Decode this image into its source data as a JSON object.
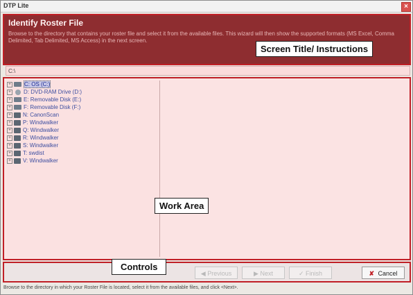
{
  "window": {
    "title": "DTP Lite",
    "close_label": "×"
  },
  "header": {
    "heading": "Identify Roster File",
    "instructions": "Browse to the directory that contains your roster file and select it from the available files. This wizard will then show the supported formats (MS Excel, Comma Delimited, Tab Delimited, MS Access) in the next screen."
  },
  "callouts": {
    "screen_title": "Screen Title/ Instructions",
    "work_area": "Work Area",
    "controls": "Controls"
  },
  "path": "C:\\",
  "tree": [
    {
      "expander": "+",
      "icon": "hard-drive-icon",
      "label": "C: OS (C:)",
      "selected": true
    },
    {
      "expander": "+",
      "icon": "cd-drive-icon",
      "label": "D: DVD-RAM Drive (D:)",
      "selected": false
    },
    {
      "expander": "+",
      "icon": "removable-disk-icon",
      "label": "E: Removable Disk (E:)",
      "selected": false
    },
    {
      "expander": "+",
      "icon": "removable-disk-icon",
      "label": "F: Removable Disk (F:)",
      "selected": false
    },
    {
      "expander": "+",
      "icon": "network-drive-icon",
      "label": "N: CanonScan",
      "selected": false
    },
    {
      "expander": "+",
      "icon": "network-drive-icon",
      "label": "P: Windwalker",
      "selected": false
    },
    {
      "expander": "+",
      "icon": "network-drive-icon",
      "label": "Q: Windwalker",
      "selected": false
    },
    {
      "expander": "+",
      "icon": "network-drive-icon",
      "label": "R: Windwalker",
      "selected": false
    },
    {
      "expander": "+",
      "icon": "network-drive-icon",
      "label": "S: Windwalker",
      "selected": false
    },
    {
      "expander": "+",
      "icon": "network-drive-icon",
      "label": "T: swdist",
      "selected": false
    },
    {
      "expander": "+",
      "icon": "network-drive-icon",
      "label": "V: Windwalker",
      "selected": false
    }
  ],
  "buttons": {
    "previous": "Previous",
    "next": "Next",
    "finish": "Finish",
    "cancel": "Cancel",
    "previous_glyph": "◀",
    "next_glyph": "▶",
    "finish_glyph": "✓",
    "cancel_glyph": "✘"
  },
  "status": "Browse to the directory in which your Roster File is located, select it from the available files, and click <Next>.",
  "colors": {
    "accent": "#c01f26",
    "header_bg": "#8e2d30",
    "work_bg": "#fbe3e3"
  }
}
